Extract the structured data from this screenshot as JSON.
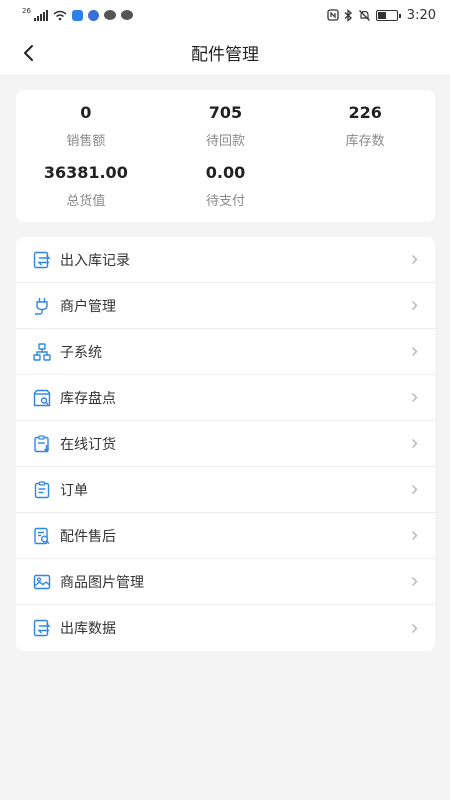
{
  "status_bar": {
    "signal_label": "26",
    "time": "3:20",
    "icons": [
      "signal-icon",
      "wifi-icon",
      "app-icon",
      "app-icon",
      "chat-icon",
      "chat-icon",
      "nfc-icon",
      "bluetooth-icon",
      "mute-icon",
      "battery-icon"
    ]
  },
  "header": {
    "title": "配件管理",
    "back_icon": "back-arrow-icon"
  },
  "stats": [
    {
      "value": "0",
      "label": "销售额"
    },
    {
      "value": "705",
      "label": "待回款"
    },
    {
      "value": "226",
      "label": "库存数"
    },
    {
      "value": "36381.00",
      "label": "总货值"
    },
    {
      "value": "0.00",
      "label": "待支付"
    }
  ],
  "menu": [
    {
      "label": "出入库记录",
      "icon": "transfer-record-icon"
    },
    {
      "label": "商户管理",
      "icon": "plug-icon"
    },
    {
      "label": "子系统",
      "icon": "org-chart-icon"
    },
    {
      "label": "库存盘点",
      "icon": "inventory-check-icon"
    },
    {
      "label": "在线订货",
      "icon": "online-order-icon"
    },
    {
      "label": "订单",
      "icon": "order-icon"
    },
    {
      "label": "配件售后",
      "icon": "after-sales-icon"
    },
    {
      "label": "商品图片管理",
      "icon": "image-icon"
    },
    {
      "label": "出库数据",
      "icon": "outbound-data-icon"
    }
  ],
  "colors": {
    "accent": "#2f86e8",
    "background": "#f4f4f5",
    "card": "#ffffff",
    "label_gray": "#8a8a8a"
  }
}
